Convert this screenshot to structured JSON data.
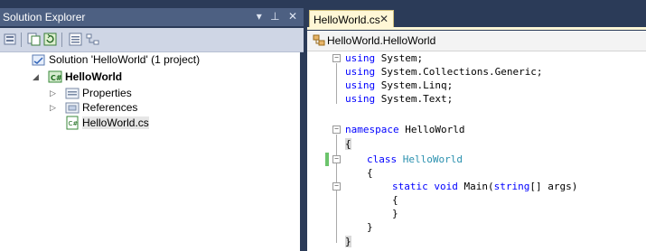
{
  "solution_explorer": {
    "title": "Solution Explorer",
    "controls": "▾ ⊥ ✕",
    "tree": {
      "solution": "Solution 'HelloWorld' (1 project)",
      "project": "HelloWorld",
      "items": [
        "Properties",
        "References",
        "HelloWorld.cs"
      ]
    }
  },
  "editor": {
    "tab_label": "HelloWorld.cs",
    "tab_close": "✕",
    "nav_label": "HelloWorld.HelloWorld",
    "code": {
      "l1_kw": "using",
      "l1_rest": " System;",
      "l2_kw": "using",
      "l2_rest": " System.Collections.Generic;",
      "l3_kw": "using",
      "l3_rest": " System.Linq;",
      "l4_kw": "using",
      "l4_rest": " System.Text;",
      "l5_kw": "namespace",
      "l5_rest": " HelloWorld",
      "l6": "{",
      "l7_kw": "class",
      "l7_type": "HelloWorld",
      "l8": "{",
      "l9_kw1": "static",
      "l9_kw2": "void",
      "l9_mid": " Main(",
      "l9_kw3": "string",
      "l9_rest": "[] args)",
      "l10": "{",
      "l11": "}",
      "l12": "}",
      "l13": "}"
    }
  },
  "colors": {
    "keyword": "#0000ff",
    "type": "#2b91af",
    "tab_active": "#fff7d6",
    "panel_title": "#4d6082"
  }
}
